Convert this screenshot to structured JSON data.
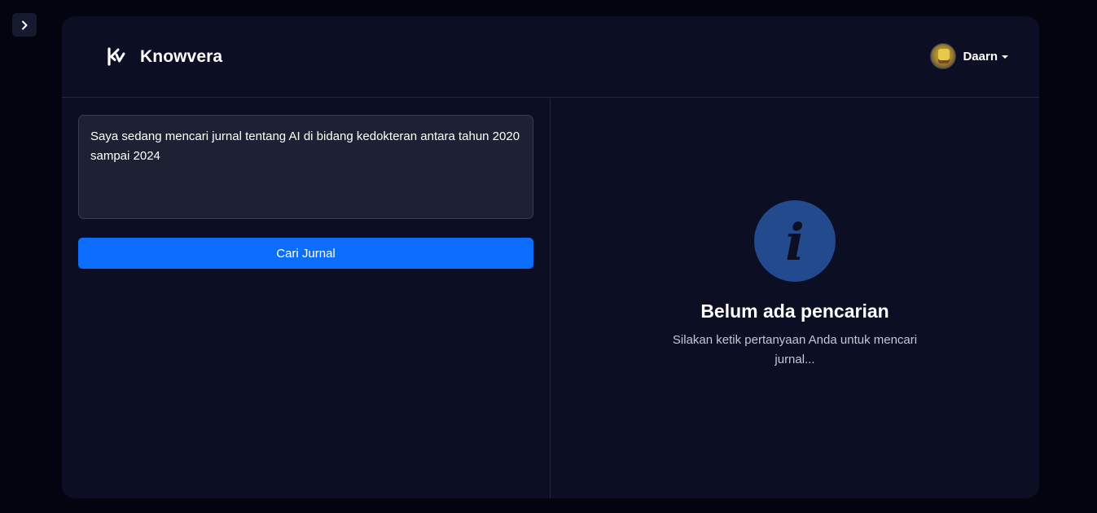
{
  "sidebar_toggle": {
    "icon": "chevron-right-icon"
  },
  "header": {
    "brand_name": "Knowvera",
    "logo_icon": "knowvera-logo-icon",
    "user": {
      "name": "Daarn",
      "avatar_icon": "user-avatar",
      "menu_icon": "caret-down-icon"
    }
  },
  "search": {
    "query_value": "Saya sedang mencari jurnal tentang AI di bidang kedokteran antara tahun 2020 sampai 2024",
    "button_label": "Cari Jurnal"
  },
  "results": {
    "empty_icon": "info-icon",
    "icon_glyph": "i",
    "empty_title": "Belum ada pencarian",
    "empty_description": "Silakan ketik pertanyaan Anda untuk mencari jurnal..."
  },
  "colors": {
    "page_background": "#03040f",
    "card_background": "#0c0f24",
    "input_background": "#1e2133",
    "accent": "#0d6efd",
    "info_circle": "#244a8e"
  }
}
